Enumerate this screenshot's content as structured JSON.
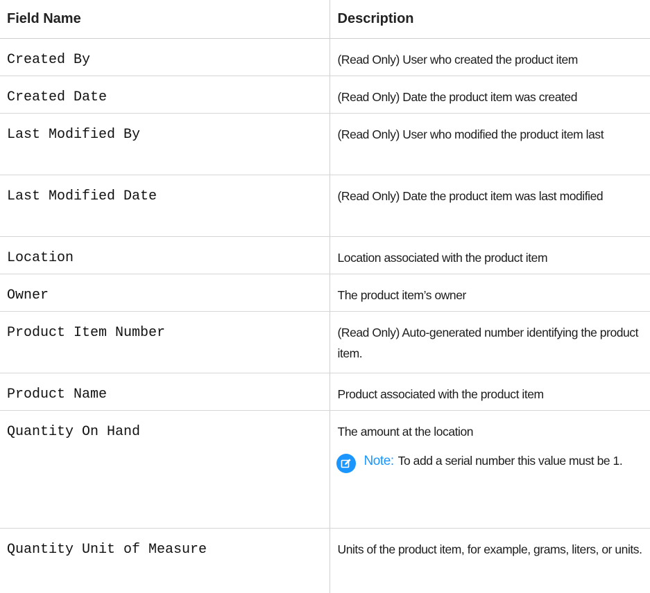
{
  "table": {
    "headers": {
      "field": "Field Name",
      "description": "Description"
    },
    "rows": [
      {
        "field": "Created By",
        "description": "(Read Only) User who created the product item"
      },
      {
        "field": "Created Date",
        "description": "(Read Only) Date the product item was created"
      },
      {
        "field": "Last Modified By",
        "description": "(Read Only) User who modified the product item last"
      },
      {
        "field": "Last Modified Date",
        "description": "(Read Only) Date the product item was last modified"
      },
      {
        "field": "Location",
        "description": "Location associated with the product item"
      },
      {
        "field": "Owner",
        "description": "The product item’s owner"
      },
      {
        "field": "Product Item Number",
        "description": "(Read Only) Auto-generated number identifying the product item."
      },
      {
        "field": "Product Name",
        "description": "Product associated with the product item"
      },
      {
        "field": "Quantity On Hand",
        "description": "The amount at the location",
        "note": {
          "icon": "note-edit-icon",
          "label": "Note:",
          "text": "To add a serial number this value must be 1."
        }
      },
      {
        "field": "Quantity Unit of Measure",
        "description": "Units of the product item, for example, grams, liters, or units."
      }
    ]
  },
  "colors": {
    "note_accent": "#1b96ff",
    "border": "#d6d6d6",
    "text": "#1a1a1a"
  }
}
